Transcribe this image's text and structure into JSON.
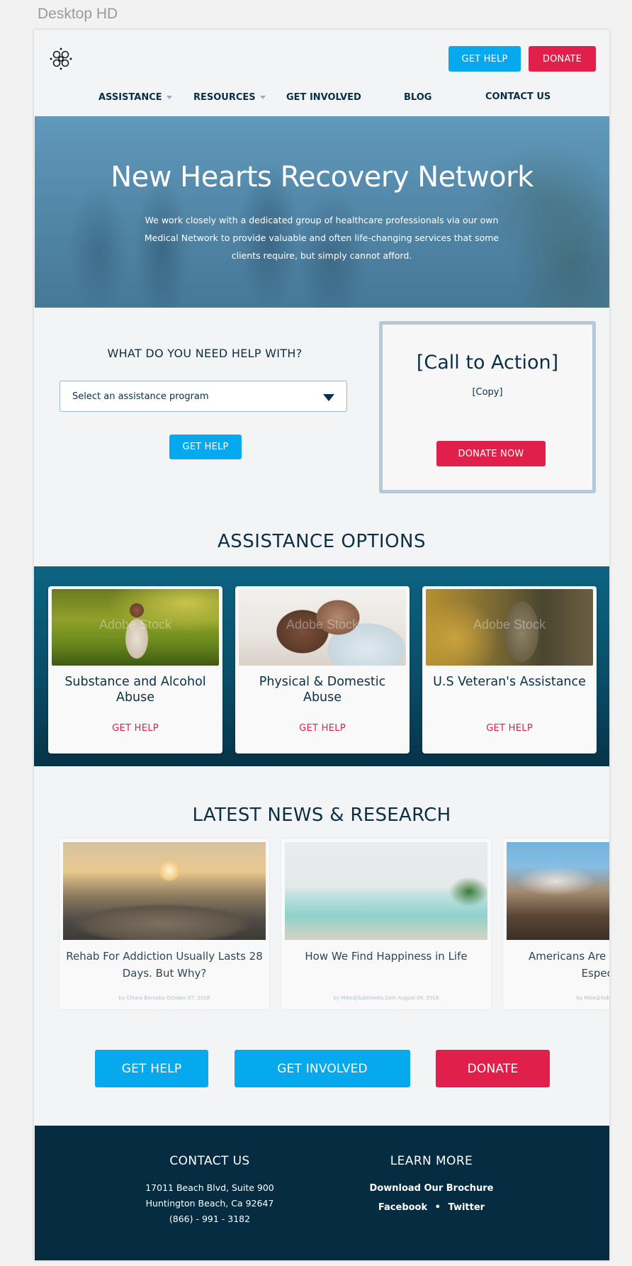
{
  "canvas": {
    "label": "Desktop HD"
  },
  "header": {
    "get_help_label": "GET HELP",
    "donate_label": "DONATE"
  },
  "nav": {
    "items": [
      {
        "label": "ASSISTANCE",
        "has_dropdown": true
      },
      {
        "label": "RESOURCES",
        "has_dropdown": true
      },
      {
        "label": "GET INVOLVED",
        "has_dropdown": false
      },
      {
        "label": "BLOG",
        "has_dropdown": false
      },
      {
        "label": "CONTACT US",
        "has_dropdown": false
      }
    ]
  },
  "hero": {
    "title": "New Hearts Recovery Network",
    "text": "We work closely with a dedicated group of healthcare professionals via our own Medical Network to provide valuable and often life-changing services that some clients require, but simply cannot afford."
  },
  "help": {
    "question": "WHAT DO YOU NEED HELP WITH?",
    "select_value": "Select an assistance program",
    "button_label": "GET HELP"
  },
  "cta": {
    "title": "[Call to Action]",
    "copy": "[Copy]",
    "button_label": "DONATE NOW"
  },
  "assistance": {
    "title": "ASSISTANCE OPTIONS",
    "watermark": "Adobe Stock",
    "cards": [
      {
        "title": "Substance and Alcohol Abuse",
        "link": "GET HELP"
      },
      {
        "title": "Physical & Domestic Abuse",
        "link": "GET HELP"
      },
      {
        "title": "U.S Veteran's Assistance",
        "link": "GET HELP"
      }
    ]
  },
  "news": {
    "title": "LATEST NEWS & RESEARCH",
    "items": [
      {
        "headline": "Rehab For Addiction Usually Lasts 28 Days. But Why?",
        "byline": "by Chiara Barnaba October 07, 2016"
      },
      {
        "headline": "How We Find Happiness in Life",
        "byline": "by Mike@Sublimehs.Com August 08, 2016"
      },
      {
        "headline": "Americans Are Drinking More, Especially",
        "byline": "by Mike@Sublimehs.Com"
      }
    ]
  },
  "bottom_cta": {
    "get_help": "GET HELP",
    "get_involved": "GET INVOLVED",
    "donate": "DONATE"
  },
  "footer": {
    "contact_title": "CONTACT US",
    "address1": "17011 Beach Blvd, Suite 900",
    "address2": "Huntington Beach, Ca 92647",
    "phone": "(866) - 991 - 3182",
    "learn_title": "LEARN MORE",
    "brochure": "Download Our Brochure",
    "facebook": "Facebook",
    "separator": "•",
    "twitter": "Twitter"
  },
  "colors": {
    "navy": "#0b2f45",
    "blue": "#06a8ee",
    "red": "#e0204a",
    "footer": "#052c40",
    "band": "#0a4d68"
  }
}
